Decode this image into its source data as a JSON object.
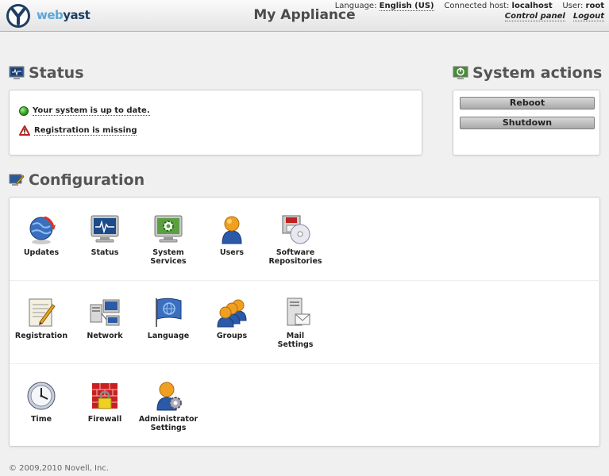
{
  "header": {
    "brand_web": "web",
    "brand_yast": "yast",
    "title": "My Appliance",
    "language_label": "Language:",
    "language_value": "English (US)",
    "host_label": "Connected host:",
    "host_value": "localhost",
    "user_label": "User:",
    "user_value": "root",
    "control_panel": "Control panel",
    "logout": "Logout"
  },
  "status": {
    "title": "Status",
    "items": [
      {
        "text": "Your system is up to date.",
        "icon": "ok-icon"
      },
      {
        "text": "Registration is missing",
        "icon": "warning-icon"
      }
    ]
  },
  "system_actions": {
    "title": "System actions",
    "reboot": "Reboot",
    "shutdown": "Shutdown"
  },
  "configuration": {
    "title": "Configuration",
    "rows": [
      [
        {
          "label1": "Updates",
          "label2": "",
          "icon": "updates-icon"
        },
        {
          "label1": "Status",
          "label2": "",
          "icon": "status-monitor-icon"
        },
        {
          "label1": "System",
          "label2": "Services",
          "icon": "system-services-icon"
        },
        {
          "label1": "Users",
          "label2": "",
          "icon": "user-icon"
        },
        {
          "label1": "Software",
          "label2": "Repositories",
          "icon": "software-repositories-icon"
        }
      ],
      [
        {
          "label1": "Registration",
          "label2": "",
          "icon": "registration-icon"
        },
        {
          "label1": "Network",
          "label2": "",
          "icon": "network-icon"
        },
        {
          "label1": "Language",
          "label2": "",
          "icon": "language-flag-icon"
        },
        {
          "label1": "Groups",
          "label2": "",
          "icon": "groups-icon"
        },
        {
          "label1": "Mail",
          "label2": "Settings",
          "icon": "mail-settings-icon"
        }
      ],
      [
        {
          "label1": "Time",
          "label2": "",
          "icon": "clock-icon"
        },
        {
          "label1": "Firewall",
          "label2": "",
          "icon": "firewall-icon"
        },
        {
          "label1": "Administrator",
          "label2": "Settings",
          "icon": "administrator-settings-icon"
        }
      ]
    ]
  },
  "footer": {
    "copyright": "© 2009,2010 Novell, Inc."
  }
}
